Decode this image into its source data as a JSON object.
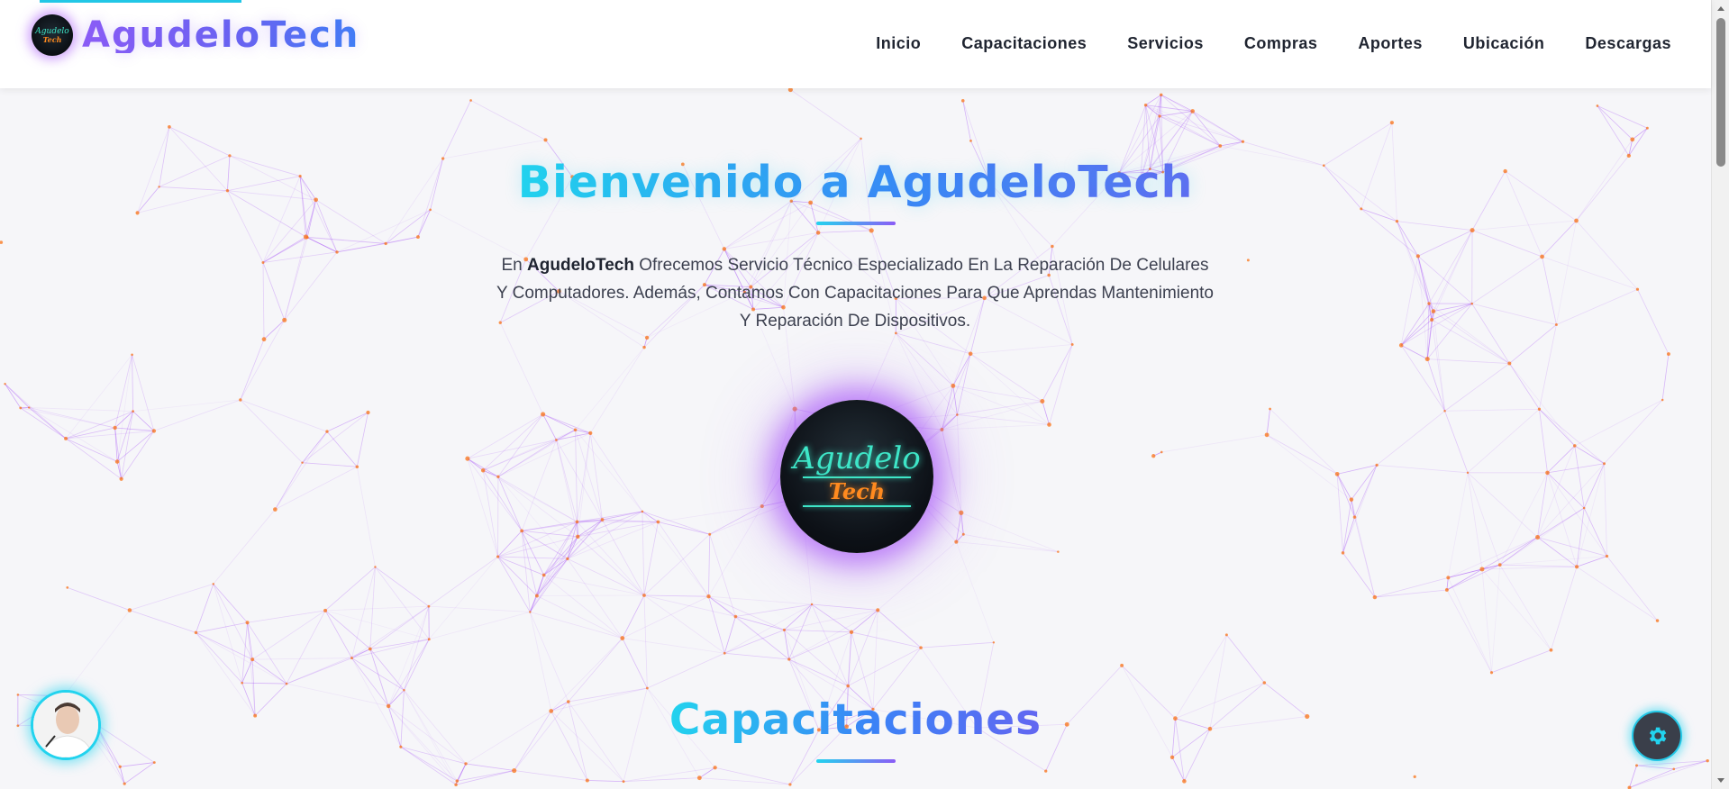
{
  "brand": {
    "name": "AgudeloTech",
    "logo_line1": "Agudelo",
    "logo_line2": "Tech"
  },
  "nav": {
    "items": [
      {
        "label": "Inicio"
      },
      {
        "label": "Capacitaciones"
      },
      {
        "label": "Servicios"
      },
      {
        "label": "Compras"
      },
      {
        "label": "Aportes"
      },
      {
        "label": "Ubicación"
      },
      {
        "label": "Descargas"
      }
    ]
  },
  "hero": {
    "title": "Bienvenido a AgudeloTech",
    "text_prefix": "En ",
    "text_bold": "AgudeloTech",
    "text_rest": " Ofrecemos Servicio Técnico Especializado En La Reparación De Celulares Y Computadores. Además, Contamos Con Capacitaciones Para Que Aprendas Mantenimiento Y Reparación De Dispositivos.",
    "logo_line1": "Agudelo",
    "logo_line2": "Tech"
  },
  "section": {
    "title": "Capacitaciones"
  },
  "floating": {
    "avatar_icon": "user-avatar-icon",
    "settings_icon": "gear-icon"
  },
  "colors": {
    "accent_cyan": "#22d3ee",
    "accent_purple": "#8b5cf6",
    "accent_blue": "#3b82f6",
    "network_line": "#a855f7",
    "network_node": "#f97316"
  }
}
